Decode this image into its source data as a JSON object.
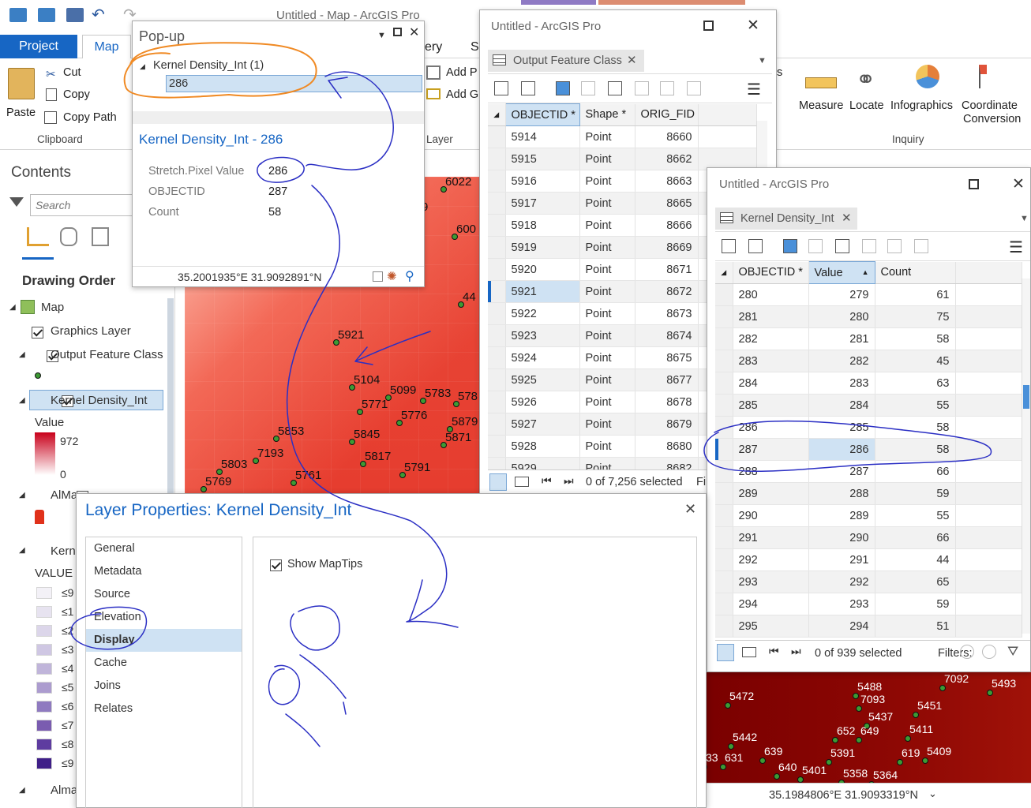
{
  "app": {
    "title": "Untitled - Map - ArcGIS Pro"
  },
  "tabs": {
    "project": "Project",
    "map": "Map"
  },
  "ribbon": {
    "paste": "Paste",
    "cut": "Cut",
    "copy": "Copy",
    "copy_path": "Copy Path",
    "clipboard": "Clipboard",
    "gallery": "ery",
    "s_frag": "S",
    "add_p": "Add P",
    "add_g": "Add G",
    "layer": "Layer",
    "s_right": "s",
    "measure": "Measure",
    "locate": "Locate",
    "infographics": "Infographics",
    "coord1": "Coordinate",
    "coord2": "Conversion",
    "inquiry": "Inquiry"
  },
  "contents": {
    "title": "Contents",
    "search_placeholder": "Search",
    "drawing_order": "Drawing Order",
    "map": "Map",
    "graphics_layer": "Graphics Layer",
    "output_fc": "Output Feature Class",
    "kernel": "Kernel Density_Int",
    "value": "Value",
    "max": "972",
    "min": "0",
    "alma": "AlMa",
    "kern": "Kern",
    "value_caps": "VALUE",
    "almas": "Alma",
    "legend_classes": [
      "≤9",
      "≤1",
      "≤2",
      "≤3",
      "≤4",
      "≤5",
      "≤6",
      "≤7",
      "≤8",
      "≤9"
    ]
  },
  "popup": {
    "title": "Pop-up",
    "layer": "Kernel Density_Int  (1)",
    "feature": "286",
    "header": "Kernel Density_Int - 286",
    "fields": [
      {
        "label": "Stretch.Pixel Value",
        "value": "286"
      },
      {
        "label": "OBJECTID",
        "value": "287"
      },
      {
        "label": "Count",
        "value": "58"
      }
    ],
    "coords": "35.2001935°E 31.9092891°N"
  },
  "ofc": {
    "window_title": "Untitled - ArcGIS Pro",
    "tab": "Output Feature Class",
    "headers": [
      "OBJECTID *",
      "Shape *",
      "ORIG_FID"
    ],
    "rows": [
      [
        "5914",
        "Point",
        "8660"
      ],
      [
        "5915",
        "Point",
        "8662"
      ],
      [
        "5916",
        "Point",
        "8663"
      ],
      [
        "5917",
        "Point",
        "8665"
      ],
      [
        "5918",
        "Point",
        "8666"
      ],
      [
        "5919",
        "Point",
        "8669"
      ],
      [
        "5920",
        "Point",
        "8671"
      ],
      [
        "5921",
        "Point",
        "8672"
      ],
      [
        "5922",
        "Point",
        "8673"
      ],
      [
        "5923",
        "Point",
        "8674"
      ],
      [
        "5924",
        "Point",
        "8675"
      ],
      [
        "5925",
        "Point",
        "8677"
      ],
      [
        "5926",
        "Point",
        "8678"
      ],
      [
        "5927",
        "Point",
        "8679"
      ],
      [
        "5928",
        "Point",
        "8680"
      ],
      [
        "5929",
        "Point",
        "8682"
      ]
    ],
    "selected_row": "5921",
    "status": "0 of 7,256 selected",
    "status_right": "Fi"
  },
  "kd": {
    "window_title": "Untitled - ArcGIS Pro",
    "tab": "Kernel Density_Int",
    "headers": [
      "OBJECTID *",
      "Value",
      "Count"
    ],
    "rows": [
      [
        "280",
        "279",
        "61"
      ],
      [
        "281",
        "280",
        "75"
      ],
      [
        "282",
        "281",
        "58"
      ],
      [
        "283",
        "282",
        "45"
      ],
      [
        "284",
        "283",
        "63"
      ],
      [
        "285",
        "284",
        "55"
      ],
      [
        "286",
        "285",
        "58"
      ],
      [
        "287",
        "286",
        "58"
      ],
      [
        "288",
        "287",
        "66"
      ],
      [
        "289",
        "288",
        "59"
      ],
      [
        "290",
        "289",
        "55"
      ],
      [
        "291",
        "290",
        "66"
      ],
      [
        "292",
        "291",
        "44"
      ],
      [
        "293",
        "292",
        "65"
      ],
      [
        "294",
        "293",
        "59"
      ],
      [
        "295",
        "294",
        "51"
      ]
    ],
    "status": "0 of 939 selected",
    "filters": "Filters:"
  },
  "layer_props": {
    "title": "Layer Properties: Kernel Density_Int",
    "nav": [
      "General",
      "Metadata",
      "Source",
      "Elevation",
      "Display",
      "Cache",
      "Joins",
      "Relates"
    ],
    "active": "Display",
    "show_maptips": "Show MapTips"
  },
  "map": {
    "labels": [
      {
        "t": "6022"
      },
      {
        "t": "600"
      },
      {
        "t": "44"
      },
      {
        "t": "5921"
      },
      {
        "t": "5104"
      },
      {
        "t": "5099"
      },
      {
        "t": "5771"
      },
      {
        "t": "5776"
      },
      {
        "t": "5783"
      },
      {
        "t": "578"
      },
      {
        "t": "5879"
      },
      {
        "t": "5871"
      },
      {
        "t": "5853"
      },
      {
        "t": "5845"
      },
      {
        "t": "7193"
      },
      {
        "t": "5817"
      },
      {
        "t": "5803"
      },
      {
        "t": "5791"
      },
      {
        "t": "5761"
      },
      {
        "t": "5769"
      },
      {
        "t": "9"
      }
    ],
    "labels2": [
      {
        "t": "7092"
      },
      {
        "t": "5488"
      },
      {
        "t": "5493"
      },
      {
        "t": "5472"
      },
      {
        "t": "7093"
      },
      {
        "t": "5451"
      },
      {
        "t": "5437"
      },
      {
        "t": "652"
      },
      {
        "t": "649"
      },
      {
        "t": "5411"
      },
      {
        "t": "5442"
      },
      {
        "t": "639"
      },
      {
        "t": "5391"
      },
      {
        "t": "619"
      },
      {
        "t": "5409"
      },
      {
        "t": "33"
      },
      {
        "t": "631"
      },
      {
        "t": "640"
      },
      {
        "t": "5401"
      },
      {
        "t": "5358"
      },
      {
        "t": "5364"
      }
    ],
    "coords": "35.1984806°E 31.9093319°N"
  },
  "colors": {
    "accent": "#0f6ec8",
    "selection": "#cfe2f3",
    "annotation_blue": "#2b2fc4",
    "annotation_orange": "#f08a24"
  }
}
